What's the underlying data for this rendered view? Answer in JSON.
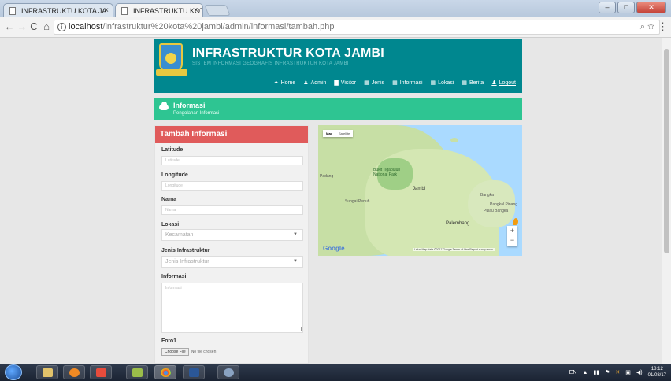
{
  "browser": {
    "tabs": [
      {
        "title": "INFRASTRUKTU KOTA JA"
      },
      {
        "title": "INFRASTRUKTU KOTA JA"
      }
    ],
    "close_glyph": "×",
    "address": {
      "host": "localhost",
      "path": "/infrastruktur%20kota%20jambi/admin/informasi/tambah.php"
    },
    "nav": {
      "back": "←",
      "forward": "→",
      "reload": "C",
      "home": "⌂"
    },
    "zoom_icon": "⌕",
    "star_icon": "☆",
    "menu_icon": "⋮",
    "window_buttons": {
      "minimize": "–",
      "maximize": "□",
      "close": "✕"
    }
  },
  "site": {
    "title": "INFRASTRUKTUR KOTA JAMBI",
    "subtitle": "SISTEM INFORMASI GEOGRAFIS INFRASTRUKTUR KOTA JAMBI",
    "nav": [
      {
        "icon": "home-icon",
        "glyph": "✦",
        "label": "Home"
      },
      {
        "icon": "user-icon",
        "glyph": "♟",
        "label": "Admin"
      },
      {
        "icon": "chart-icon",
        "glyph": "▇",
        "label": "Visitor"
      },
      {
        "icon": "grid-icon",
        "glyph": "▦",
        "label": "Jenis"
      },
      {
        "icon": "grid-icon",
        "glyph": "▦",
        "label": "Informasi"
      },
      {
        "icon": "grid-icon",
        "glyph": "▦",
        "label": "Lokasi"
      },
      {
        "icon": "grid-icon",
        "glyph": "▦",
        "label": "Berita"
      },
      {
        "icon": "user-icon",
        "glyph": "♟",
        "label": "Logout"
      }
    ]
  },
  "infobar": {
    "title": "Informasi",
    "subtitle": "Pengolahan Informasi"
  },
  "form": {
    "heading": "Tambah Informasi",
    "latitude": {
      "label": "Latitude",
      "placeholder": "Latitude"
    },
    "longitude": {
      "label": "Longitude",
      "placeholder": "Longitude"
    },
    "nama": {
      "label": "Nama",
      "placeholder": "Nama"
    },
    "lokasi": {
      "label": "Lokasi",
      "selected": "Kecamatan"
    },
    "jenis": {
      "label": "Jenis Infrastruktur",
      "selected": "Jenis Infrastruktur"
    },
    "informasi": {
      "label": "Informasi",
      "placeholder": "Informasi"
    },
    "foto": {
      "label": "Foto1",
      "button": "Choose File",
      "status": "No file chosen"
    }
  },
  "map": {
    "tabs": [
      "Map",
      "Satellite"
    ],
    "labels": [
      {
        "text": "Jambi"
      },
      {
        "text": "Bukit Tigapuluh National Park"
      },
      {
        "text": "Palembang"
      },
      {
        "text": "Bangka"
      },
      {
        "text": "Padang"
      },
      {
        "text": "Sungai Penuh"
      },
      {
        "text": "Pangkal Pinang"
      },
      {
        "text": "Pulau Bangka"
      }
    ],
    "zoom_in": "+",
    "zoom_out": "−",
    "brand": "Google",
    "footer": "Leluri  Map data ©2017 Google   Terms of Use   Report a map error"
  },
  "taskbar": {
    "lang": "EN",
    "time": "18:12",
    "date": "01/08/17"
  },
  "colors": {
    "header": "#00878f",
    "infobar": "#2ec592",
    "form_head": "#e05b5b"
  }
}
